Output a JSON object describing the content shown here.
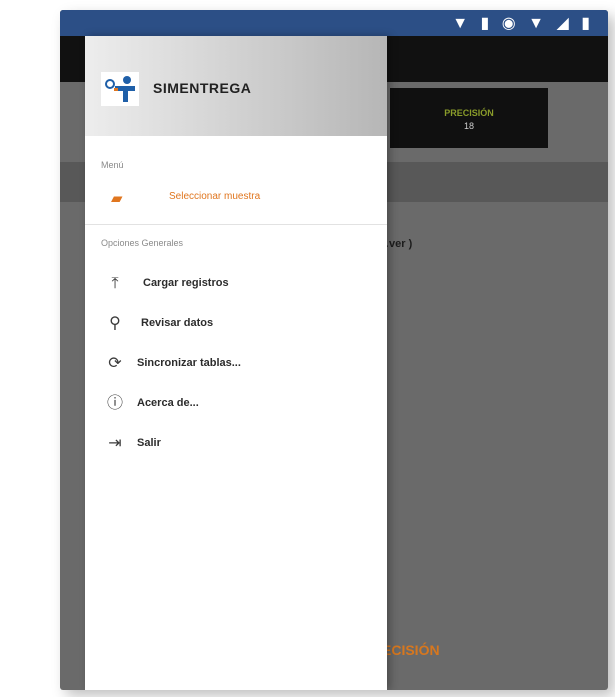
{
  "status_bar": {
    "icons": "▼ ▮ ◉ ▼ ◢ ▮"
  },
  "background": {
    "metric_label": "PRECISIÓN",
    "metric_value": "18",
    "partial_text": "…ver )",
    "bottom_label": "ECISIÓN"
  },
  "drawer": {
    "brand": "SIMENTREGA",
    "menu_title": "Menú",
    "selected_item": "Seleccionar muestra",
    "options_title": "Opciones Generales",
    "items": [
      {
        "label": "Cargar registros",
        "icon": "upload-icon"
      },
      {
        "label": "Revisar datos",
        "icon": "search-icon"
      },
      {
        "label": "Sincronizar tablas...",
        "icon": "sync-icon"
      },
      {
        "label": "Acerca de...",
        "icon": "info-icon"
      },
      {
        "label": "Salir",
        "icon": "exit-icon"
      }
    ]
  },
  "colors": {
    "status_bar": "#2c4f86",
    "accent": "#e0761f",
    "metric_label": "#8a9c2a"
  }
}
